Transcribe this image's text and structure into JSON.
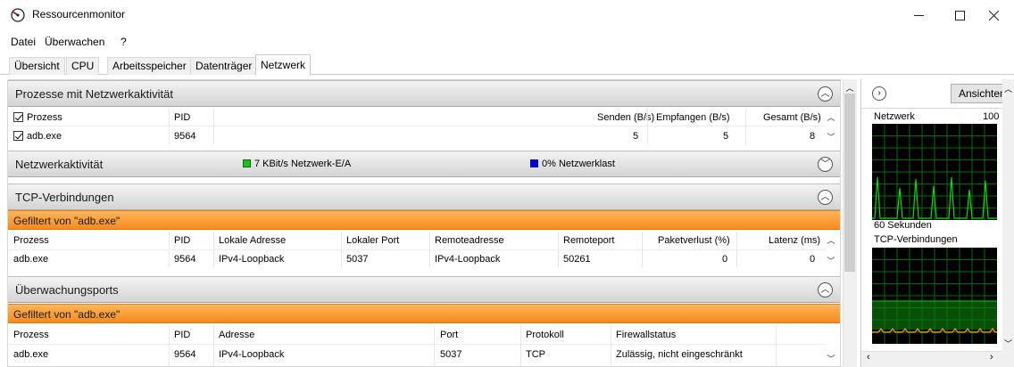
{
  "window": {
    "title": "Ressourcenmonitor",
    "controls": {
      "minimize": "—",
      "maximize": "☐",
      "close": "✕"
    }
  },
  "menu": [
    "Datei",
    "Überwachen",
    "?"
  ],
  "tabs": [
    {
      "label": "Übersicht",
      "active": false
    },
    {
      "label": "CPU",
      "active": false
    },
    {
      "label": "Arbeitsspeicher",
      "active": false
    },
    {
      "label": "Datenträger",
      "active": false
    },
    {
      "label": "Netzwerk",
      "active": true
    }
  ],
  "sections": {
    "processes": {
      "title": "Prozesse mit Netzwerkaktivität",
      "columns": [
        "Prozess",
        "PID",
        "Senden (B/s)",
        "Empfangen (B/s)",
        "Gesamt (B/s)"
      ],
      "rows": [
        {
          "process": "adb.exe",
          "pid": "9564",
          "send": "5",
          "receive": "5",
          "total": "8"
        }
      ]
    },
    "activity": {
      "title": "Netzwerkaktivität",
      "io_label": "7 KBit/s Netzwerk-E/A",
      "load_label": "0% Netzwerklast",
      "io_color": "#19c419",
      "load_color": "#0000c8"
    },
    "tcp": {
      "title": "TCP-Verbindungen",
      "filter": "Gefiltert von \"adb.exe\"",
      "columns": [
        "Prozess",
        "PID",
        "Lokale Adresse",
        "Lokaler Port",
        "Remoteadresse",
        "Remoteport",
        "Paketverlust (%)",
        "Latenz (ms)"
      ],
      "rows": [
        {
          "process": "adb.exe",
          "pid": "9564",
          "local_address": "IPv4-Loopback",
          "local_port": "5037",
          "remote_address": "IPv4-Loopback",
          "remote_port": "50261",
          "packet_loss": "0",
          "latency": "0"
        }
      ]
    },
    "ports": {
      "title": "Überwachungsports",
      "filter": "Gefiltert von \"adb.exe\"",
      "columns": [
        "Prozess",
        "PID",
        "Adresse",
        "Port",
        "Protokoll",
        "Firewallstatus"
      ],
      "rows": [
        {
          "process": "adb.exe",
          "pid": "9564",
          "address": "IPv4-Loopback",
          "port": "5037",
          "protocol": "TCP",
          "firewall": "Zulässig, nicht eingeschränkt"
        }
      ]
    }
  },
  "right_panel": {
    "views_button": "Ansichten",
    "graph1_title": "Netzwerk",
    "graph1_max": "100 I",
    "time_label": "60 Sekunden",
    "graph2_title": "TCP-Verbindungen"
  },
  "colors": {
    "filter_orange": "#f58b1d",
    "graph_green": "#00e000",
    "graph_bg": "#000000",
    "grid_green": "#0b6b0b",
    "tcp_marker": "#f5a000"
  }
}
